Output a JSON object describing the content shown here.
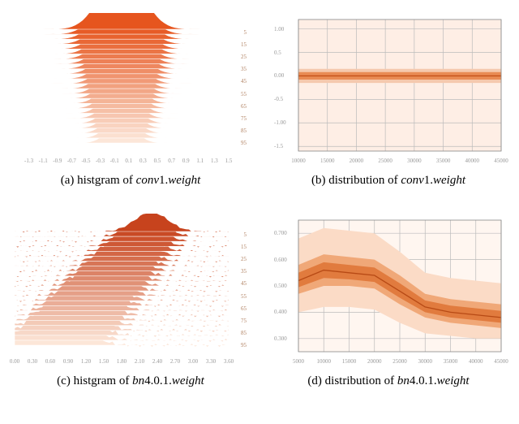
{
  "captions": {
    "a_prefix": "(a) histgram of ",
    "a_var": "conv",
    "a_mid": "1.",
    "a_suffix": "weight",
    "b_prefix": "(b) distribution of ",
    "b_var": "conv",
    "b_mid": "1.",
    "b_suffix": "weight",
    "c_prefix": "(c) histgram of ",
    "c_var": "bn",
    "c_mid": "4.0.1.",
    "c_suffix": "weight",
    "d_prefix": "(d) distribution of ",
    "d_var": "bn",
    "d_mid": "4.0.1.",
    "d_suffix": "weight"
  },
  "chart_data": [
    {
      "id": "a",
      "type": "ridgeline-histogram",
      "title": "histogram of conv1.weight",
      "x_ticks": [
        -1.3,
        -1.1,
        -0.9,
        -0.7,
        -0.5,
        -0.3,
        -0.1,
        0.1,
        0.3,
        0.5,
        0.7,
        0.9,
        1.1,
        1.3,
        1.5
      ],
      "x_range": [
        -1.5,
        1.5
      ],
      "y_right_labels": [
        5,
        15,
        25,
        35,
        45,
        55,
        65,
        75,
        85,
        95
      ],
      "color_ramp": [
        "#FCE6D8",
        "#E6551E"
      ]
    },
    {
      "id": "b",
      "type": "distribution-band",
      "title": "distribution of conv1.weight",
      "x_ticks": [
        10000,
        15000,
        20000,
        25000,
        30000,
        35000,
        40000,
        45000
      ],
      "y_ticks": [
        -1.5,
        -1.0,
        -0.5,
        0.0,
        0.5,
        1.0
      ],
      "ylim": [
        -1.6,
        1.2
      ],
      "series": [
        {
          "x": 10000,
          "median": 0.0,
          "q25": -0.08,
          "q75": 0.08,
          "min": -0.15,
          "max": 0.15
        },
        {
          "x": 20000,
          "median": 0.0,
          "q25": -0.08,
          "q75": 0.08,
          "min": -0.15,
          "max": 0.15
        },
        {
          "x": 30000,
          "median": 0.0,
          "q25": -0.08,
          "q75": 0.08,
          "min": -0.15,
          "max": 0.15
        },
        {
          "x": 45000,
          "median": 0.0,
          "q25": -0.08,
          "q75": 0.08,
          "min": -0.15,
          "max": 0.15
        }
      ]
    },
    {
      "id": "c",
      "type": "ridgeline-histogram",
      "title": "histogram of bn4.0.1.weight",
      "x_ticks": [
        0.0,
        0.3,
        0.6,
        0.9,
        1.2,
        1.5,
        1.8,
        2.1,
        2.4,
        2.7,
        3.0,
        3.3,
        3.6
      ],
      "x_range": [
        0.0,
        3.6
      ],
      "y_right_labels": [
        5,
        15,
        25,
        35,
        45,
        55,
        65,
        75,
        85,
        95
      ],
      "color_ramp": [
        "#FCE6D8",
        "#C7431D"
      ]
    },
    {
      "id": "d",
      "type": "distribution-band",
      "title": "distribution of bn4.0.1.weight",
      "x_ticks": [
        5000,
        10000,
        15000,
        20000,
        25000,
        30000,
        35000,
        40000,
        45000
      ],
      "y_ticks": [
        0.3,
        0.4,
        0.5,
        0.6,
        0.7
      ],
      "ylim": [
        0.25,
        0.75
      ],
      "series": [
        {
          "x": 5000,
          "median": 0.52,
          "q25": 0.47,
          "q75": 0.58,
          "min": 0.4,
          "max": 0.68
        },
        {
          "x": 10000,
          "median": 0.56,
          "q25": 0.5,
          "q75": 0.62,
          "min": 0.42,
          "max": 0.72
        },
        {
          "x": 15000,
          "median": 0.55,
          "q25": 0.5,
          "q75": 0.61,
          "min": 0.42,
          "max": 0.71
        },
        {
          "x": 20000,
          "median": 0.54,
          "q25": 0.49,
          "q75": 0.6,
          "min": 0.41,
          "max": 0.7
        },
        {
          "x": 25000,
          "median": 0.48,
          "q25": 0.43,
          "q75": 0.54,
          "min": 0.36,
          "max": 0.63
        },
        {
          "x": 30000,
          "median": 0.42,
          "q25": 0.38,
          "q75": 0.47,
          "min": 0.32,
          "max": 0.55
        },
        {
          "x": 35000,
          "median": 0.4,
          "q25": 0.36,
          "q75": 0.45,
          "min": 0.31,
          "max": 0.53
        },
        {
          "x": 40000,
          "median": 0.39,
          "q25": 0.35,
          "q75": 0.44,
          "min": 0.3,
          "max": 0.52
        },
        {
          "x": 45000,
          "median": 0.38,
          "q25": 0.34,
          "q75": 0.43,
          "min": 0.3,
          "max": 0.51
        }
      ]
    }
  ]
}
